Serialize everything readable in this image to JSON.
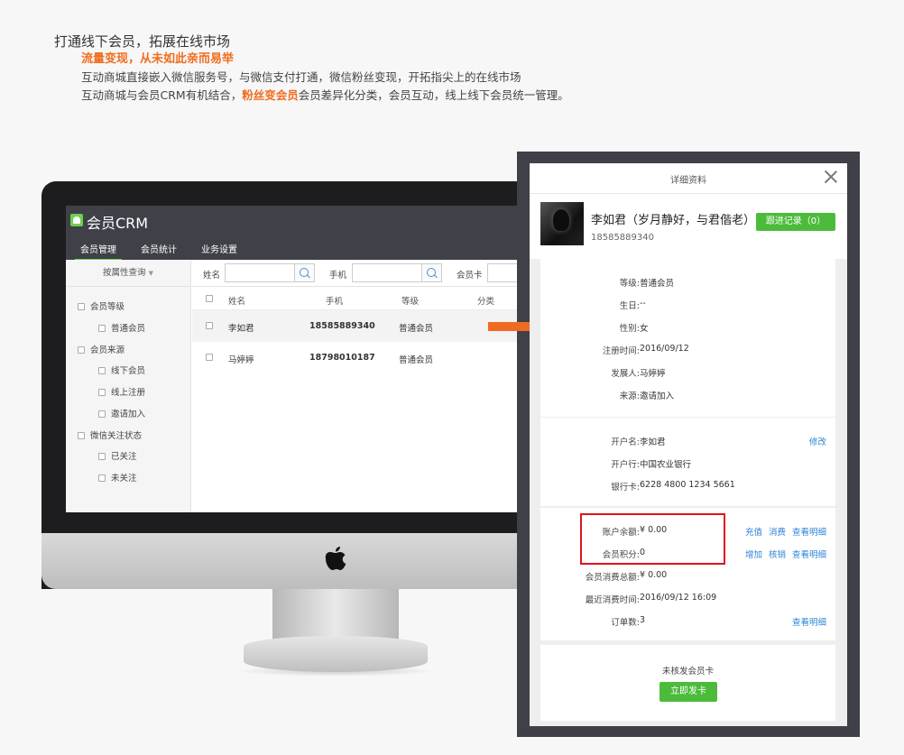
{
  "intro": {
    "title": "打通线下会员，拓展在线市场",
    "subtitle": "流量变现，从未如此亲而易举",
    "line1": "互动商城直接嵌入微信服务号，与微信支付打通，微信粉丝变现，开拓指尖上的在线市场",
    "line2_pre": "互动商城与会员CRM有机结合，",
    "line2_highlight": "粉丝变会员",
    "line2_post": "会员差异化分类，会员互动，线上线下会员统一管理。"
  },
  "crm": {
    "app_title": "会员CRM",
    "tabs": [
      "会员管理",
      "会员统计",
      "业务设置"
    ],
    "filter_label": "按属性查询",
    "tree": {
      "level": "会员等级",
      "level_normal": "普通会员",
      "source": "会员来源",
      "source_offline": "线下会员",
      "source_online": "线上注册",
      "source_invite": "邀请加入",
      "wechat": "微信关注状态",
      "wechat_followed": "已关注",
      "wechat_unfollowed": "未关注"
    },
    "search": {
      "name_label": "姓名",
      "phone_label": "手机",
      "card_label": "会员卡"
    },
    "columns": [
      "姓名",
      "手机",
      "等级",
      "分类"
    ],
    "rows": [
      {
        "name": "李如君",
        "phone": "18585889340",
        "level": "普通会员"
      },
      {
        "name": "马婷婷",
        "phone": "18798010187",
        "level": "普通会员"
      }
    ]
  },
  "detail": {
    "title": "详细资料",
    "name": "李如君（岁月静好，与君偕老）",
    "phone": "18585889340",
    "follow_button": "跟进记录（0）",
    "info": {
      "level_label": "等级:",
      "level": "普通会员",
      "birthday_label": "生日:",
      "birthday": "--",
      "gender_label": "性别:",
      "gender": "女",
      "register_label": "注册时间:",
      "register": "2016/09/12",
      "referrer_label": "发展人:",
      "referrer": "马婷婷",
      "source_label": "来源:",
      "source": "邀请加入"
    },
    "bank": {
      "holder_label": "开户名:",
      "holder": "李如君",
      "bank_label": "开户行:",
      "bank": "中国农业银行",
      "card_label": "银行卡:",
      "card": "6228 4800 1234 5661",
      "edit": "修改"
    },
    "account": {
      "balance_label": "账户余额:",
      "balance": "¥ 0.00",
      "points_label": "会员积分:",
      "points": "0",
      "total_label": "会员消费总额:",
      "total": "¥ 0.00",
      "last_label": "最近消费时间:",
      "last": "2016/09/12 16:09",
      "orders_label": "订单数:",
      "orders": "3",
      "recharge": "充值",
      "consume": "消费",
      "detail": "查看明细",
      "add": "增加",
      "verify": "核销"
    },
    "card_status": "未核发会员卡",
    "issue_button": "立即发卡"
  },
  "colors": {
    "accent_green": "#4cbb3a",
    "accent_orange": "#f26b1d",
    "link_blue": "#2d84d6",
    "highlight_red": "#e0131b",
    "dark_frame": "#3f4048"
  }
}
